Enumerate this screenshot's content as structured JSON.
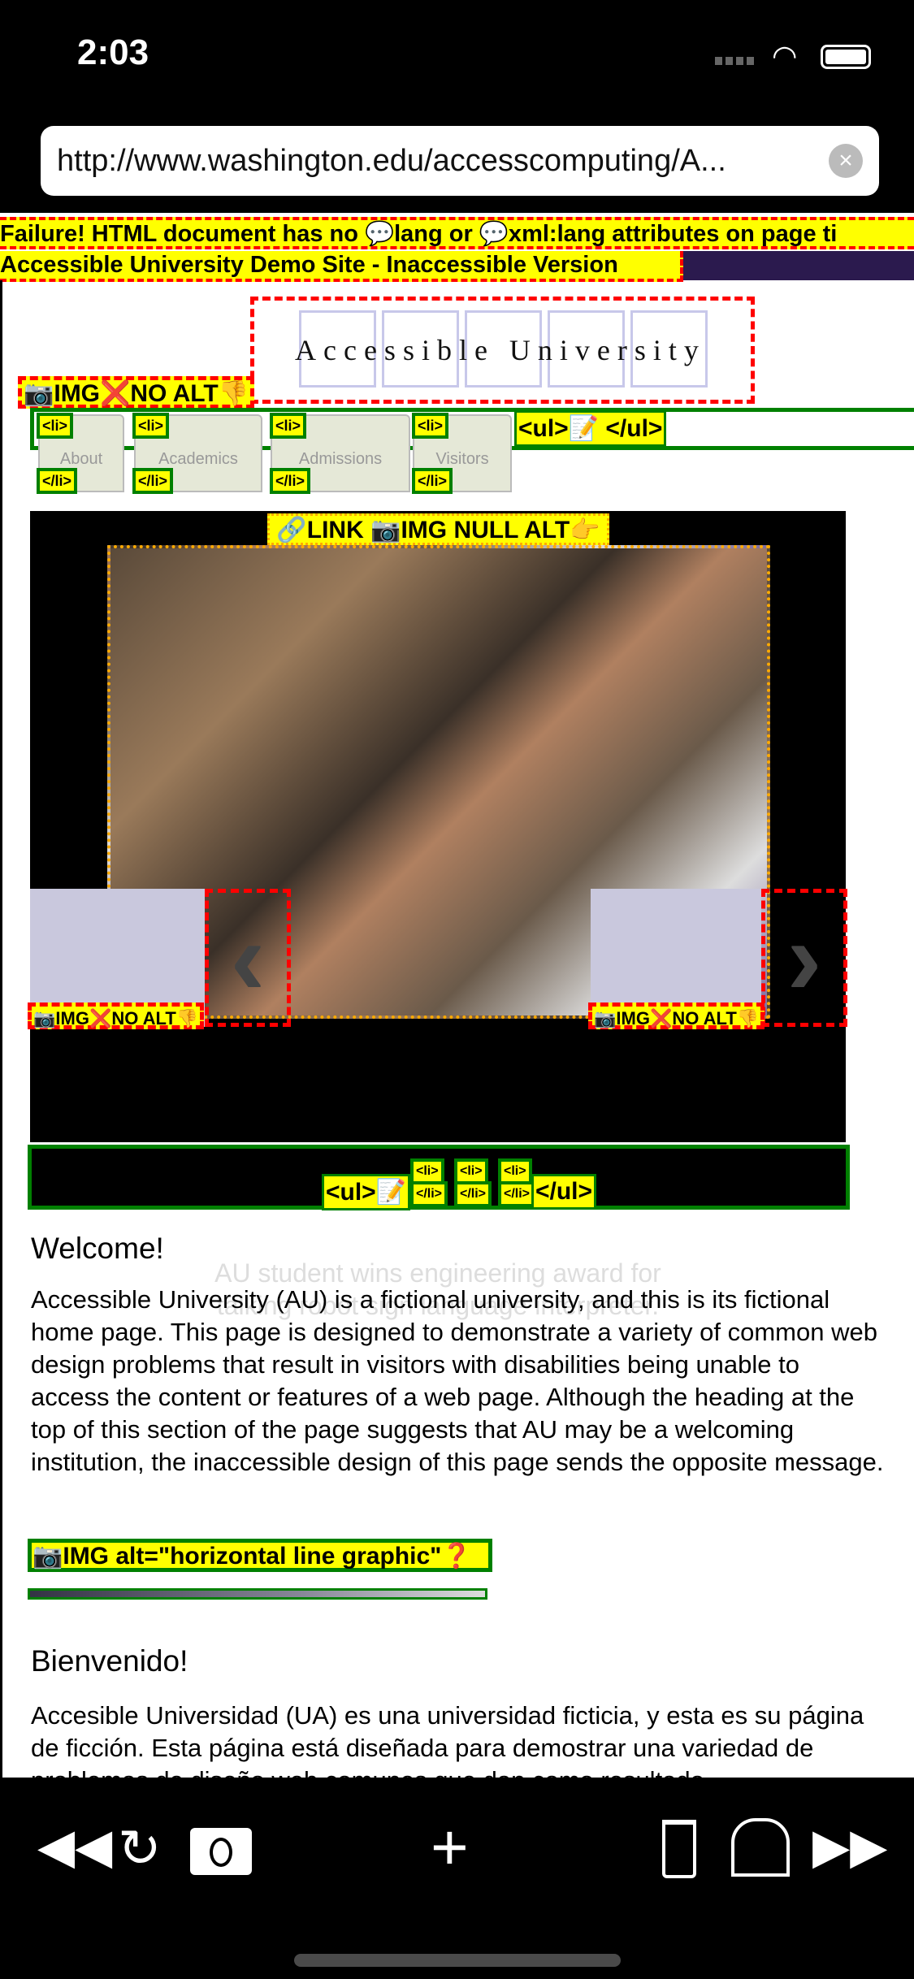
{
  "status_bar": {
    "time": "2:03"
  },
  "browser": {
    "url": "http://www.washington.edu/accesscomputing/A..."
  },
  "banners": {
    "failure": "Failure! HTML document has no 💬lang or 💬xml:lang attributes on page ti",
    "site_title": "Accessible University Demo Site - Inaccessible Version"
  },
  "logo": {
    "text": "Accessible University"
  },
  "labels": {
    "img_no_alt": "📷IMG❌NO ALT👎",
    "li_open": "<li>",
    "li_close": "</li>",
    "ul_open": "<ul>📝",
    "ul_close": "</ul>",
    "link_img_null_alt": "🔗LINK 📷IMG NULL ALT👉",
    "img_alt_hr": "📷IMG alt=\"horizontal line graphic\"❓"
  },
  "nav": {
    "tabs": [
      "About",
      "Academics",
      "Admissions",
      "Visitors"
    ]
  },
  "slideshow": {
    "caption": "AU student wins engineering award for talking robot sign language interpreter.",
    "prev": "‹",
    "next": "›"
  },
  "content": {
    "welcome_heading": "Welcome!",
    "welcome_text": "Accessible University (AU) is a fictional university, and this is its fictional home page. This page is designed to demonstrate a variety of common web design problems that result in visitors with disabilities being unable to access the content or features of a web page. Although the heading at the top of this section of the page suggests that AU may be a welcoming institution, the inaccessible design of this page sends the opposite message.",
    "bienvenido_heading": "Bienvenido!",
    "bienvenido_text": "Accesible Universidad (UA) es una universidad ficticia, y esta es su página de ficción. Esta página está diseñada para demostrar una variedad de problemas de diseño web comunes que dan como resultado"
  },
  "colors": {
    "label_bg": "#ffff00",
    "ok_border": "#008000",
    "fail_border": "#ff0000",
    "site_bar": "#2b1a4e"
  }
}
